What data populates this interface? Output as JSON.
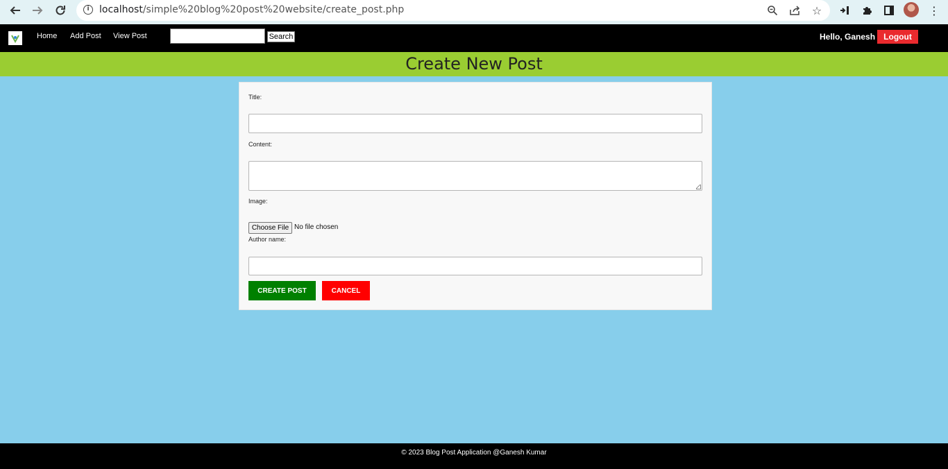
{
  "browser": {
    "url_host": "localhost",
    "url_path": "/simple%20blog%20post%20website/create_post.php"
  },
  "navbar": {
    "links": [
      "Home",
      "Add Post",
      "View Post"
    ],
    "search_button": "Search",
    "greeting": "Hello, Ganesh",
    "logout": "Logout"
  },
  "header": {
    "title": "Create New Post"
  },
  "form": {
    "title_label": "Title:",
    "content_label": "Content:",
    "image_label": "Image:",
    "file_button": "Choose File",
    "file_status": "No file chosen",
    "author_label": "Author name:",
    "submit": "CREATE POST",
    "cancel": "CANCEL"
  },
  "footer": {
    "text": "© 2023 Blog Post Application @Ganesh Kumar"
  },
  "colors": {
    "page_bg": "#87ceeb",
    "header_bg": "#9acd32",
    "navbar_bg": "#000000",
    "logout_bg": "#ea2a2e",
    "create_bg": "#008000",
    "cancel_bg": "#ff0000"
  }
}
